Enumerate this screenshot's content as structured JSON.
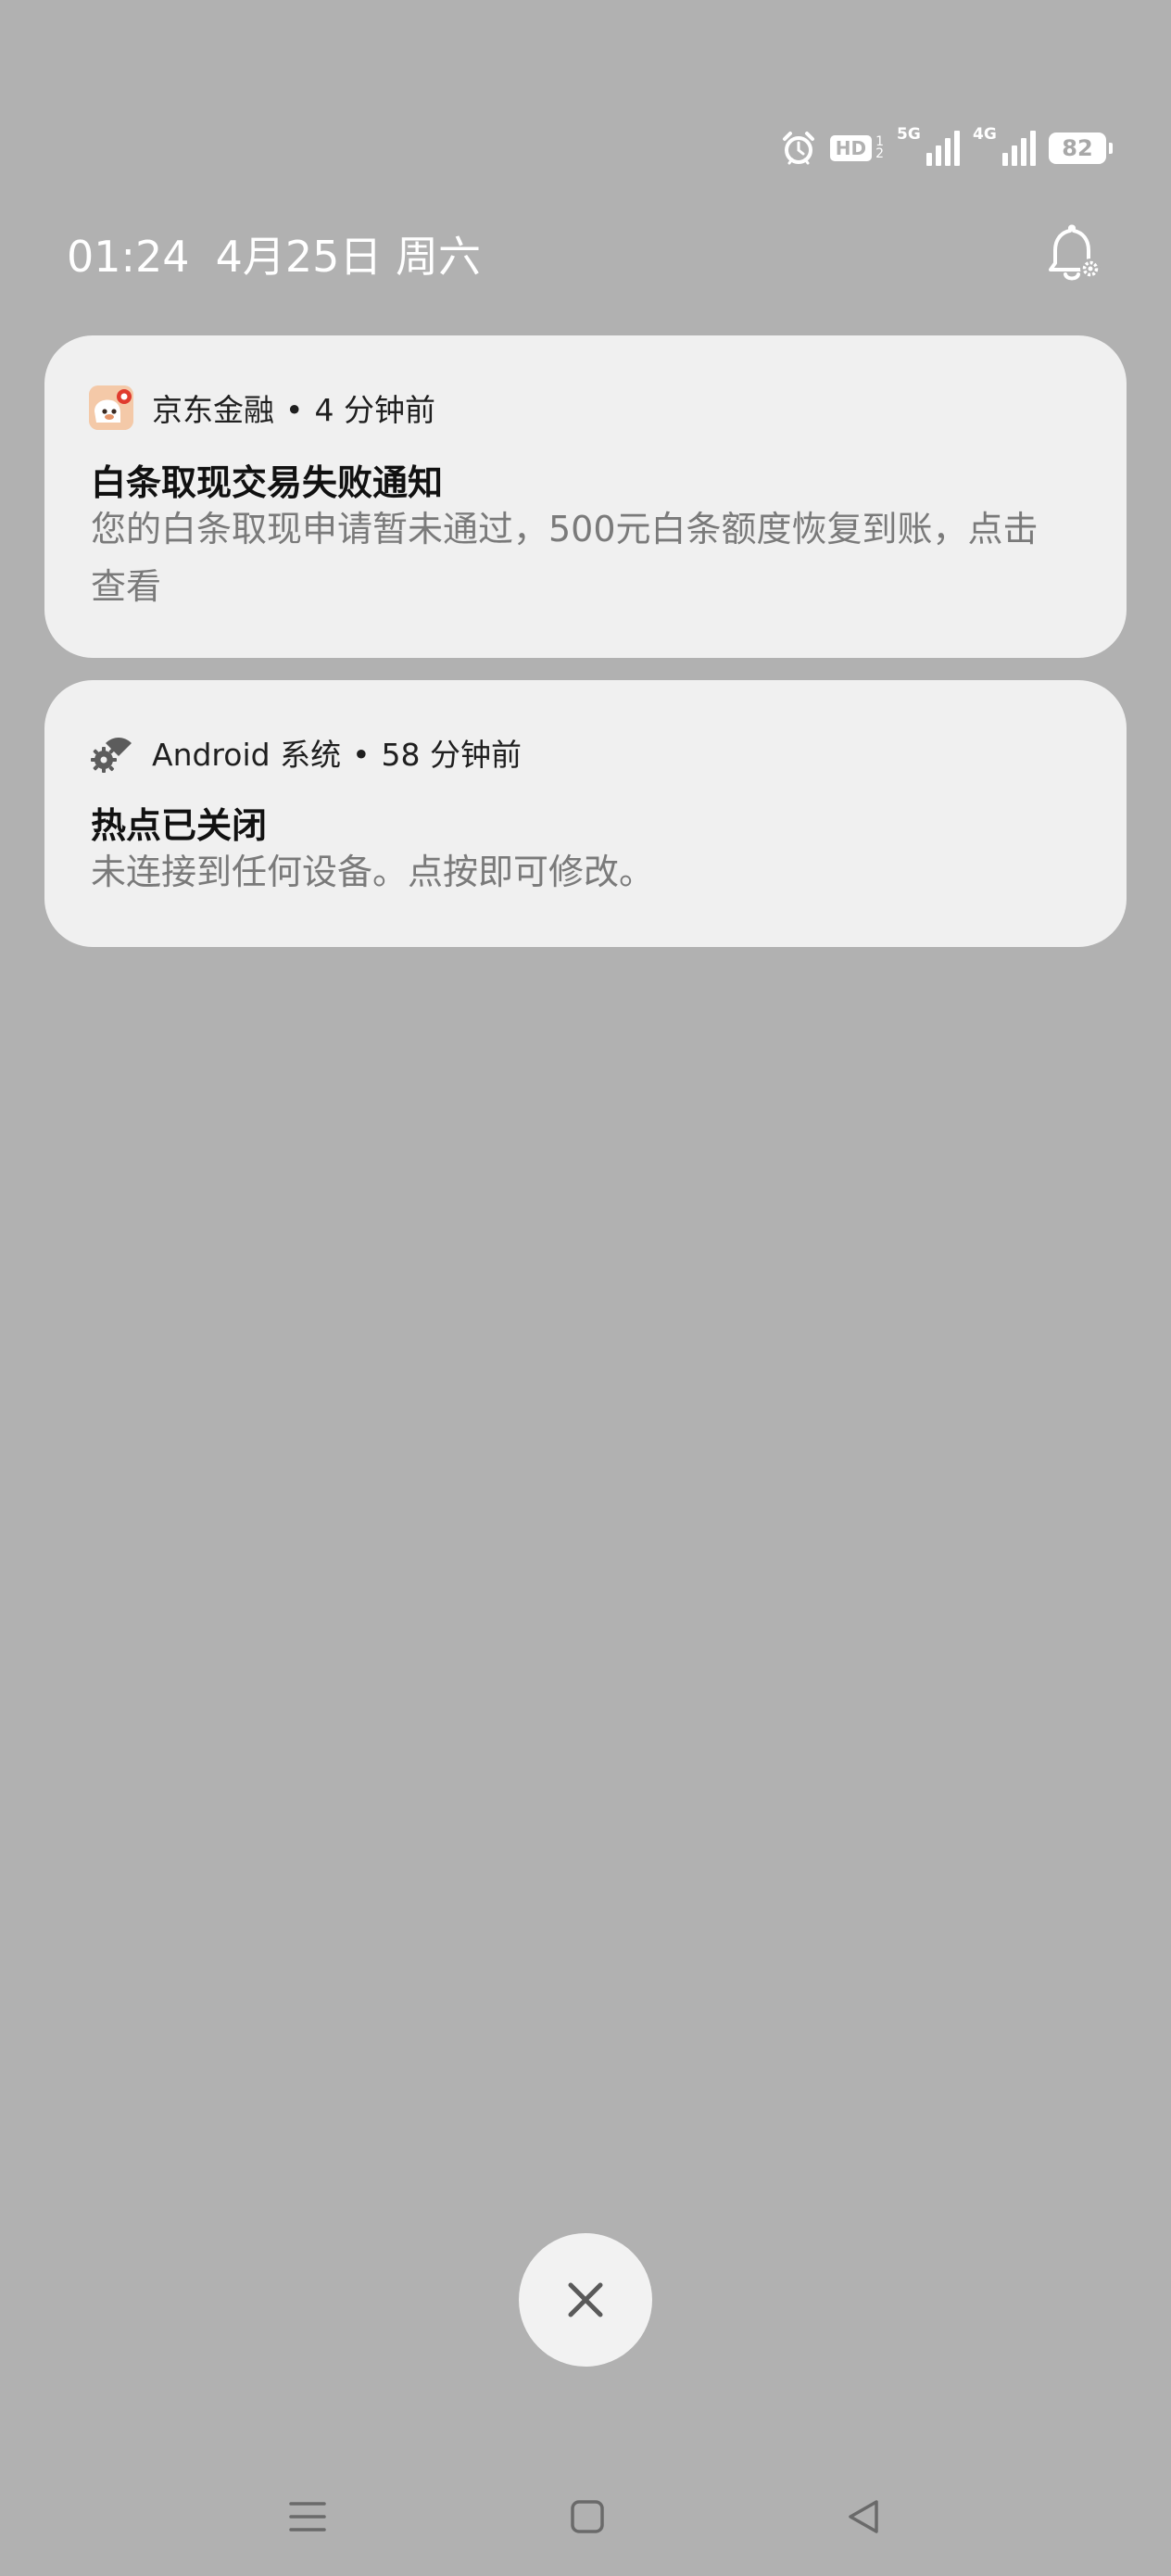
{
  "status_bar": {
    "alarm_icon": "alarm-clock-icon",
    "hd_label": "HD",
    "hd_fraction_top": "1",
    "hd_fraction_bottom": "2",
    "signal_1_label": "5G",
    "signal_2_label": "4G",
    "battery_level": "82"
  },
  "header": {
    "time": "01:24",
    "date": "4月25日 周六",
    "settings_icon": "bell-settings-icon"
  },
  "notifications": [
    {
      "app_name": "京东金融",
      "separator": "•",
      "time_ago": "4 分钟前",
      "title": "白条取现交易失败通知",
      "body": "您的白条取现申请暂未通过，500元白条额度恢复到账，点击查看",
      "icon": "jd-finance-app-icon"
    },
    {
      "app_name": "Android 系统",
      "separator": "•",
      "time_ago": "58 分钟前",
      "title": "热点已关闭",
      "body": "未连接到任何设备。点按即可修改。",
      "icon": "android-system-settings-icon"
    }
  ],
  "clear_all": {
    "icon": "close-icon"
  },
  "nav_bar": {
    "menu_icon": "menu-icon",
    "home_icon": "home-icon",
    "back_icon": "back-icon"
  },
  "colors": {
    "background": "#b1b1b1",
    "card": "#f0f0f0",
    "title_text": "#111111",
    "body_text": "#7a7a7a"
  }
}
